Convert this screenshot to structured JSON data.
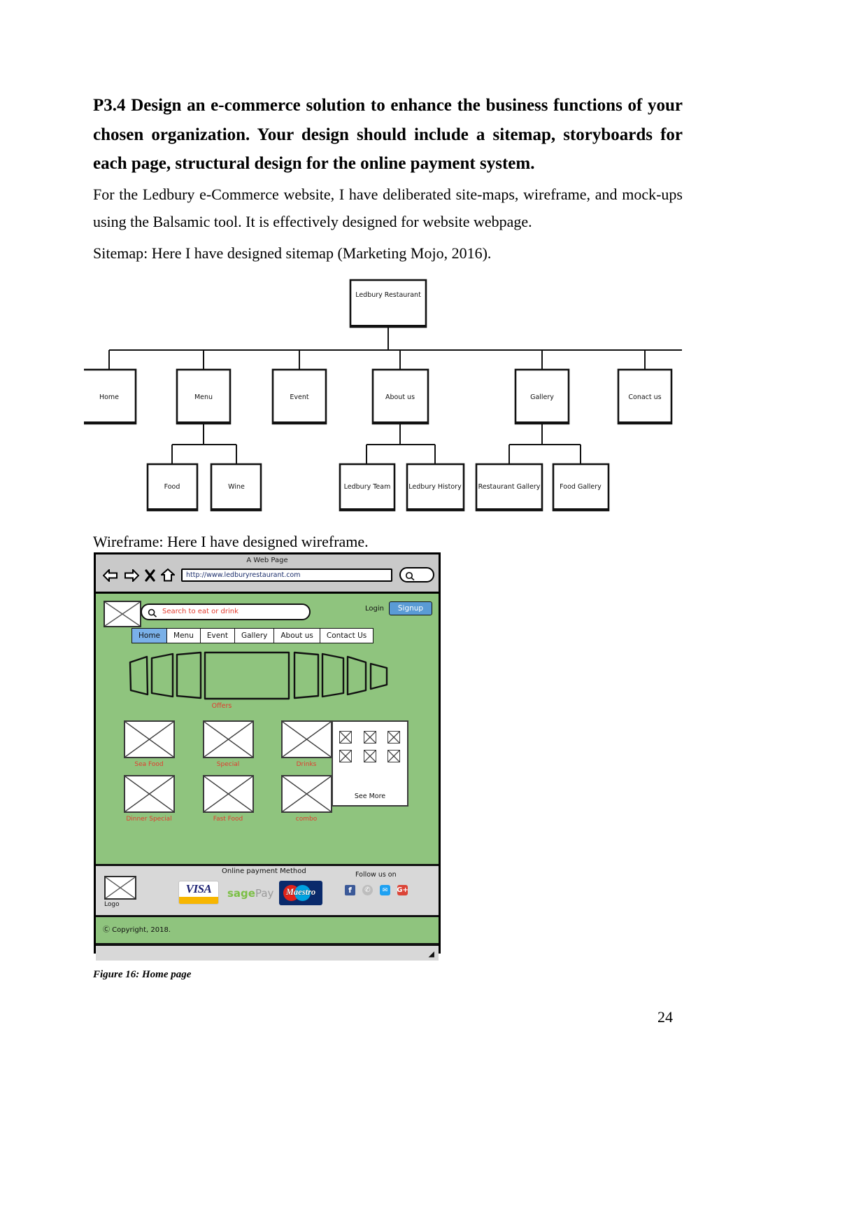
{
  "document": {
    "heading": "P3.4 Design an e-commerce solution to enhance the business functions of your chosen organization. Your design should include a sitemap, storyboards for each page, structural design for the online payment system.",
    "paragraph_1": " For the Ledbury e-Commerce website, I have deliberated site-maps, wireframe, and mock-ups using the Balsamic tool. It is effectively designed for website webpage.",
    "paragraph_2": "Sitemap: Here I have designed sitemap (Marketing Mojo, 2016).",
    "paragraph_3": "Wireframe: Here I have designed wireframe.",
    "figure_caption": "Figure 16: Home page",
    "page_number": "24"
  },
  "sitemap": {
    "root": "Ledbury Restaurant",
    "level1": [
      {
        "label": "Home"
      },
      {
        "label": "Menu"
      },
      {
        "label": "Event"
      },
      {
        "label": "About us"
      },
      {
        "label": "Gallery"
      },
      {
        "label": "Conact us"
      }
    ],
    "level2": [
      {
        "label": "Food"
      },
      {
        "label": "Wine"
      },
      {
        "label": "Ledbury Team"
      },
      {
        "label": "Ledbury History"
      },
      {
        "label": "Restaurant Gallery"
      },
      {
        "label": "Food Gallery"
      }
    ]
  },
  "wireframe": {
    "browser": {
      "window_title": "A Web Page",
      "url": "http://www.ledburyrestaurant.com",
      "icons": [
        "back-arrow-icon",
        "forward-arrow-icon",
        "close-x-icon",
        "home-icon",
        "search-icon"
      ]
    },
    "header": {
      "logo_alt": "logo-placeholder",
      "search_placeholder": "Search to eat or drink",
      "login_label": "Login",
      "signup_label": "Signup"
    },
    "nav_items": [
      "Home",
      "Menu",
      "Event",
      "Gallery",
      "About us",
      "Contact Us"
    ],
    "nav_active": "Home",
    "carousel_label": "Offers",
    "tiles": [
      {
        "label": "Sea Food"
      },
      {
        "label": "Special"
      },
      {
        "label": "Drinks"
      },
      {
        "label": "Dinner Special"
      },
      {
        "label": "Fast Food"
      },
      {
        "label": "combo"
      }
    ],
    "see_more_label": "See More",
    "footer": {
      "logo_caption": "Logo",
      "payment_title": "Online payment Method",
      "payment_methods": [
        "VISA",
        "sagePay",
        "Maestro"
      ],
      "visa_text": "VISA",
      "sage_text_1": "sage",
      "sage_text_2": "Pay",
      "maestro_text": "Maestro",
      "follow_title": "Follow us on",
      "social": [
        "facebook-icon",
        "whatsapp-icon",
        "twitter-icon",
        "google-plus-icon"
      ],
      "social_glyphs": [
        "f",
        "✆",
        "✉",
        "G+"
      ]
    },
    "copyright": "Ⓒ Copyright, 2018."
  },
  "colors": {
    "page_bg": "#8fc47e",
    "chrome_gray": "#c9c9c9",
    "footer_gray": "#d8d8d8",
    "accent_blue": "#5a9bd5",
    "caption_red": "#e23b2e",
    "url_blue": "#1a2d6b"
  }
}
